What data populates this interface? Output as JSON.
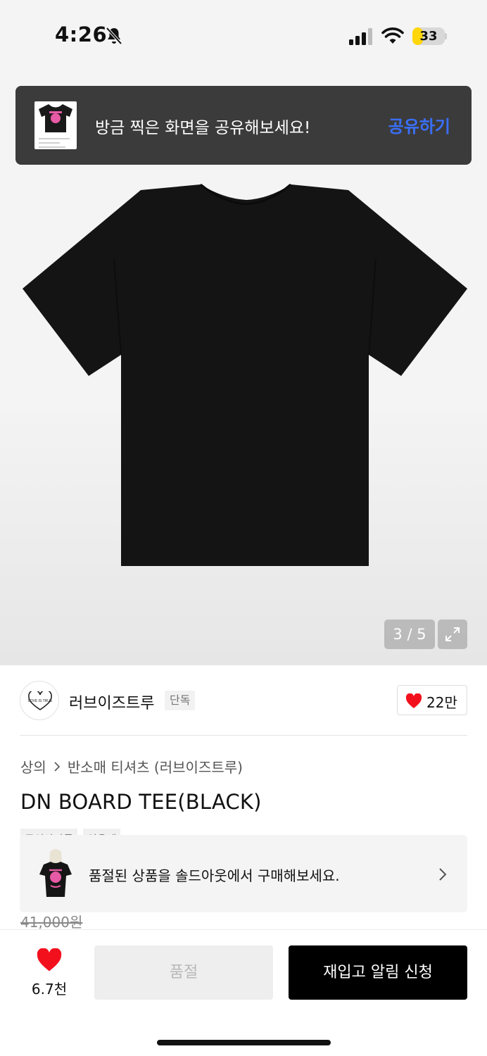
{
  "status_bar": {
    "time": "4:26",
    "battery": "33",
    "battery_level": 0.33,
    "battery_color": "#ffd60a"
  },
  "share_toast": {
    "message": "방금 찍은 화면을 공유해보세요!",
    "action": "공유하기",
    "action_color": "#3a6ff7"
  },
  "gallery": {
    "counter": "3 / 5"
  },
  "brand": {
    "name": "러브이즈트루",
    "tag": "단독",
    "logo_text": "LOVE IS TRUE",
    "likes": "22만",
    "heart_color": "#f2101d"
  },
  "product": {
    "breadcrumb": [
      "상의",
      "반소매 티셔츠 (러브이즈트루)"
    ],
    "title": "DN BOARD TEE(BLACK)",
    "badges": [
      "무신사단독",
      "인용계"
    ],
    "original_price": "41,000원"
  },
  "soldout_banner": {
    "text": "품절된 상품을 솔드아웃에서 구매해보세요."
  },
  "bottom_bar": {
    "wish_count": "6.7천",
    "soldout_label": "품절",
    "restock_label": "재입고 알림 신청"
  }
}
